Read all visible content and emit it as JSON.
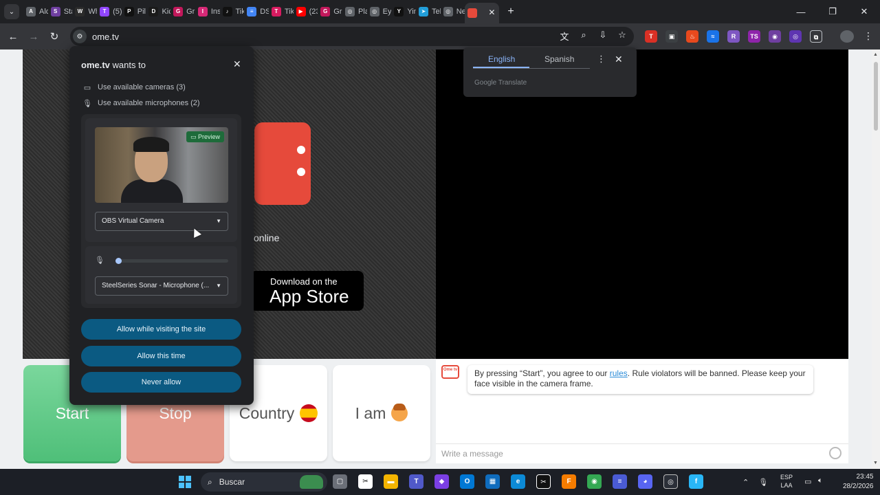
{
  "browser": {
    "tab_search_icon": "chevron-down-icon",
    "tabs": [
      {
        "title": "Alce",
        "color": "#5f6368",
        "glyph": "A"
      },
      {
        "title": "Stag",
        "color": "#6f3fa0",
        "glyph": "S"
      },
      {
        "title": "Wh",
        "color": "#2b2b2b",
        "glyph": "W"
      },
      {
        "title": "(5) F",
        "color": "#9146ff",
        "glyph": "T"
      },
      {
        "title": "Pilo",
        "color": "#111111",
        "glyph": "P"
      },
      {
        "title": "Kick",
        "color": "#1a1a1a",
        "glyph": "D"
      },
      {
        "title": "Gru",
        "color": "#c2185b",
        "glyph": "G"
      },
      {
        "title": "Inst",
        "color": "#d62976",
        "glyph": "I"
      },
      {
        "title": "Tik",
        "color": "#111111",
        "glyph": "♪"
      },
      {
        "title": "DSA",
        "color": "#4285f4",
        "glyph": "≡"
      },
      {
        "title": "Tik",
        "color": "#d81b60",
        "glyph": "T"
      },
      {
        "title": "(23",
        "color": "#ff0000",
        "glyph": "▶"
      },
      {
        "title": "Gru",
        "color": "#c2185b",
        "glyph": "G"
      },
      {
        "title": "Plar",
        "color": "#5f6368",
        "glyph": "◎"
      },
      {
        "title": "Eye",
        "color": "#5f6368",
        "glyph": "◎"
      },
      {
        "title": "Yin",
        "color": "#111111",
        "glyph": "Y"
      },
      {
        "title": "Tele",
        "color": "#229ed9",
        "glyph": "➤"
      },
      {
        "title": "Nev",
        "color": "#5f6368",
        "glyph": "◎"
      }
    ],
    "active_tab_color": "#e64a3b",
    "new_tab_label": "+",
    "url": "ome.tv",
    "window_controls": [
      "—",
      "❐",
      "✕"
    ]
  },
  "translate_bubble": {
    "source_language": "English",
    "target_language": "Spanish",
    "powered_by": "Google Translate"
  },
  "page": {
    "online_text": "online",
    "appstore_line1": "Download on the",
    "appstore_line2": "App Store",
    "buttons": {
      "start": "Start",
      "stop": "Stop",
      "country": "Country",
      "iam": "I am"
    },
    "chat": {
      "logo_text": "Ome tv",
      "message_before": "By pressing “Start”, you agree to our ",
      "message_link": "rules",
      "message_after": ". Rule violators will be banned. Please keep your face visible in the camera frame.",
      "input_placeholder": "Write a message"
    }
  },
  "permission_dialog": {
    "site": "ome.tv",
    "title_suffix": " wants to",
    "camera_permission": "Use available cameras (3)",
    "mic_permission": "Use available microphones (2)",
    "preview_label": "Preview",
    "camera_select_value": "OBS Virtual Camera",
    "mic_select_value": "SteelSeries Sonar - Microphone (...",
    "mic_level": 0.0,
    "allow_site_label": "Allow while visiting the site",
    "allow_once_label": "Allow this time",
    "never_allow_label": "Never allow"
  },
  "taskbar": {
    "search_label": "Buscar",
    "language_line1": "ESP",
    "language_line2": "LAA",
    "time": "23:45",
    "date": "28/2/2026"
  }
}
